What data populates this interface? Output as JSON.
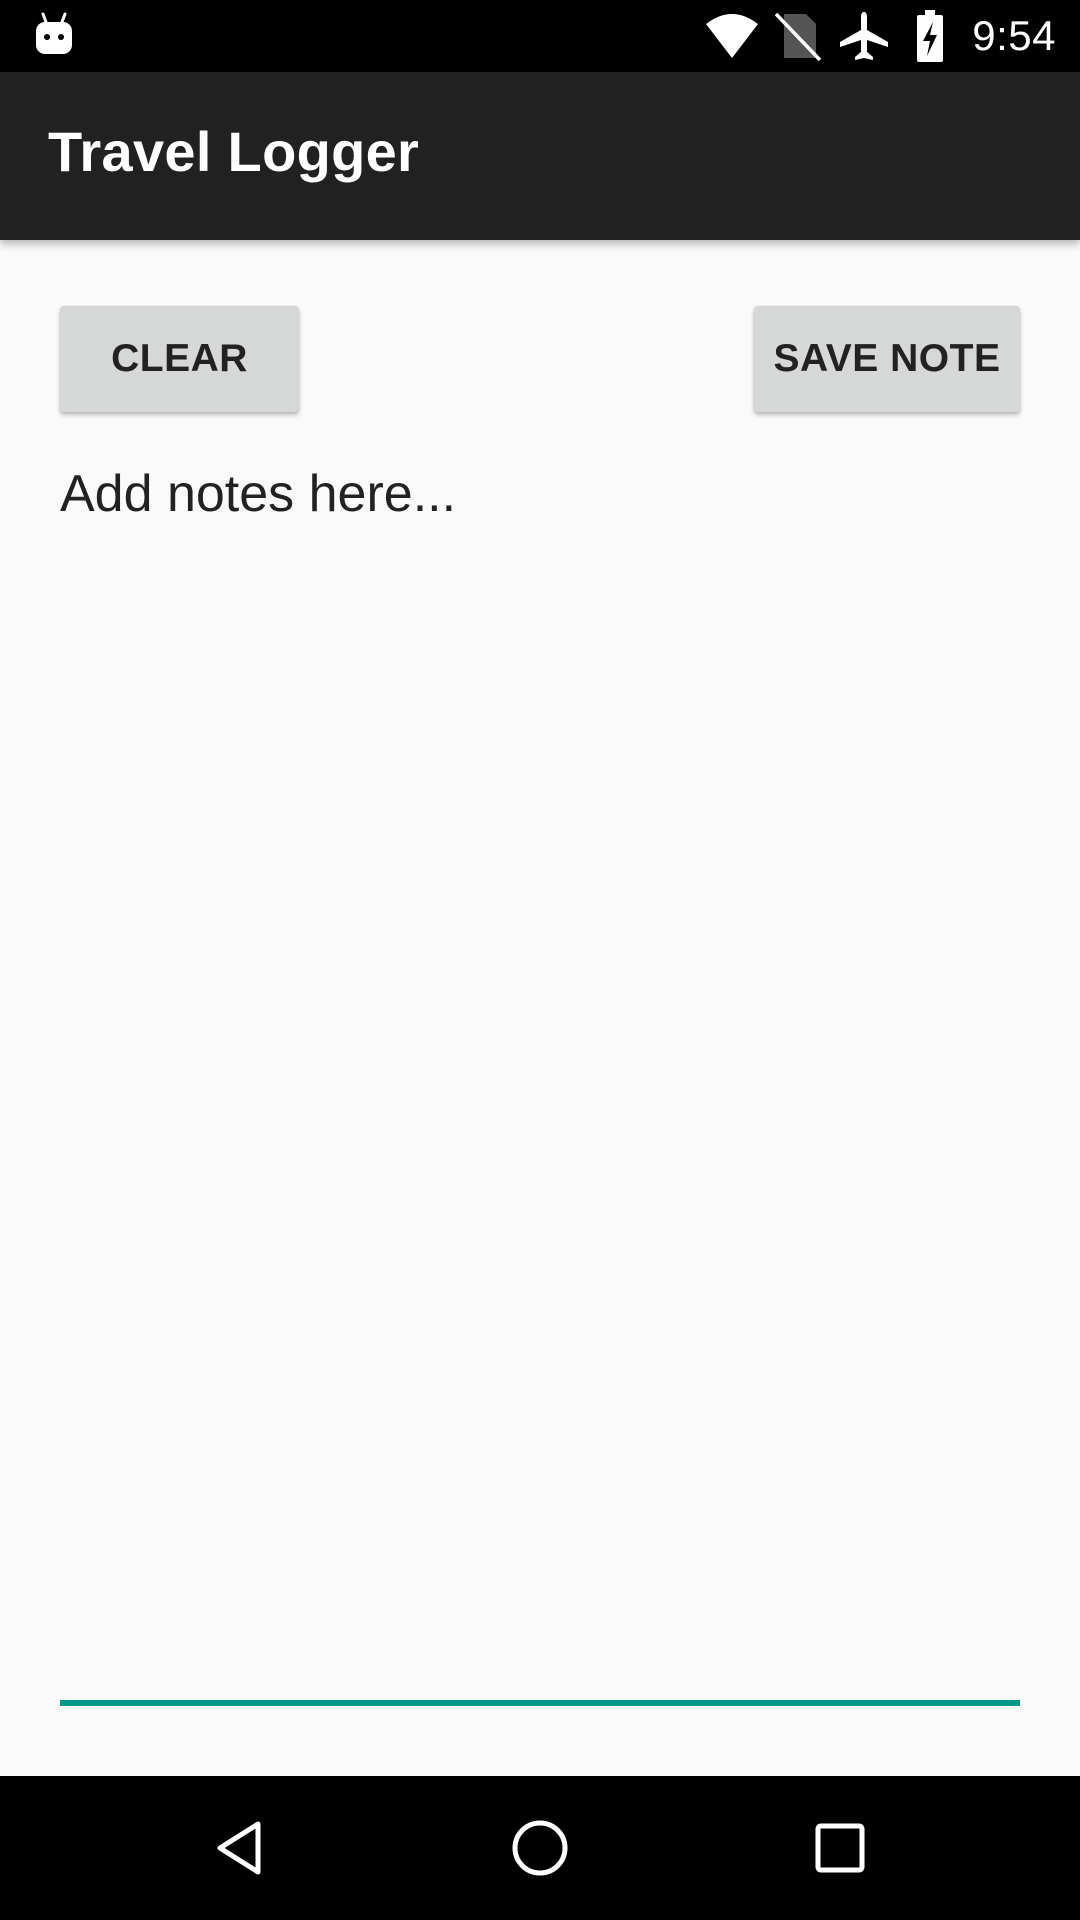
{
  "status_bar": {
    "time": "9:54",
    "left_icon": "android-notification-icon",
    "icons": [
      "wifi-icon",
      "no-sim-icon",
      "airplane-mode-icon",
      "battery-charging-icon"
    ]
  },
  "app_bar": {
    "title": "Travel Logger"
  },
  "toolbar": {
    "clear_label": "CLEAR",
    "save_label": "SAVE NOTE"
  },
  "notes": {
    "placeholder": "Add notes here...",
    "value": ""
  },
  "nav_bar": {
    "buttons": [
      "back-icon",
      "home-icon",
      "recents-icon"
    ]
  },
  "colors": {
    "app_bar": "#212121",
    "status_bar": "#000000",
    "background": "#fafafa",
    "button": "#d6d7d7",
    "accent": "#009688"
  }
}
